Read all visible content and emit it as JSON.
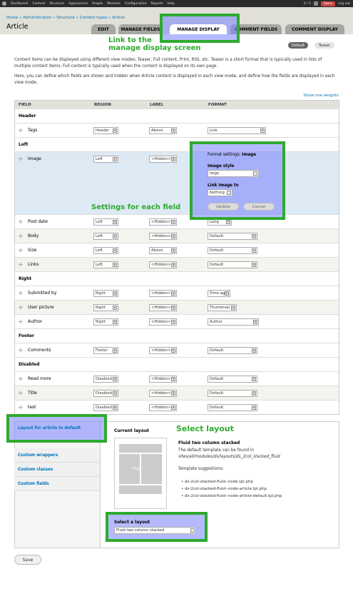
{
  "toolbar": {
    "items": [
      "Dashboard",
      "Content",
      "Structure",
      "Appearance",
      "People",
      "Modules",
      "Configuration",
      "Reports",
      "Help"
    ],
    "counter": "0 / 1",
    "user": "Sams",
    "logout": "Log out"
  },
  "breadcrumb": "Home » Administration » Structure » Content types » Article",
  "page_title": "Article",
  "tabs": [
    "EDIT",
    "MANAGE FIELDS",
    "MANAGE DISPLAY",
    "COMMENT FIELDS",
    "COMMENT DISPLAY"
  ],
  "callouts": {
    "tab_link": "Link to the\nmanage display screen",
    "settings": "Settings for each field",
    "select_layout": "Select layout"
  },
  "view_modes": {
    "default": "Default",
    "teaser": "Teaser"
  },
  "description": {
    "p1": "Content items can be displayed using different view modes: Teaser, Full content, Print, RSS, etc. Teaser is a short format that is typically used in lists of multiple content items. Full content is typically used when the content is displayed on its own page.",
    "p2": "Here, you can define which fields are shown and hidden when Article content is displayed in each view mode, and define how the fields are displayed in each view mode."
  },
  "show_row_weights": "Show row weights",
  "table": {
    "headers": [
      "FIELD",
      "REGION",
      "LABEL",
      "FORMAT"
    ],
    "rows": [
      {
        "type": "region",
        "name": "Header"
      },
      {
        "type": "field",
        "name": "Tags",
        "region": "Header",
        "label": "Above",
        "format": "Link"
      },
      {
        "type": "region",
        "name": "Left"
      },
      {
        "type": "field",
        "name": "Image",
        "region": "Left",
        "label": "<Hidden>",
        "format": ""
      },
      {
        "type": "field",
        "name": "Post date",
        "region": "Left",
        "label": "<Hidden>",
        "format": "Long"
      },
      {
        "type": "field",
        "name": "Body",
        "region": "Left",
        "label": "<Hidden>",
        "format": "Default"
      },
      {
        "type": "field",
        "name": "Size",
        "region": "Left",
        "label": "Above",
        "format": "Default"
      },
      {
        "type": "field",
        "name": "Links",
        "region": "Left",
        "label": "<Hidden>",
        "format": "Default"
      },
      {
        "type": "region",
        "name": "Right"
      },
      {
        "type": "field",
        "name": "Submitted by",
        "region": "Right",
        "label": "<Hidden>",
        "format": "Time ago"
      },
      {
        "type": "field",
        "name": "User picture",
        "region": "Right",
        "label": "<Hidden>",
        "format": "Thumbnail"
      },
      {
        "type": "field",
        "name": "Author",
        "region": "Right",
        "label": "<Hidden>",
        "format": "Author"
      },
      {
        "type": "region",
        "name": "Footer"
      },
      {
        "type": "field",
        "name": "Comments",
        "region": "Footer",
        "label": "<Hidden>",
        "format": "Default"
      },
      {
        "type": "region",
        "name": "Disabled"
      },
      {
        "type": "field",
        "name": "Read more",
        "region": "Disabled",
        "label": "<Hidden>",
        "format": "Default"
      },
      {
        "type": "field",
        "name": "Title",
        "region": "Disabled",
        "label": "<Hidden>",
        "format": "Default"
      },
      {
        "type": "field",
        "name": "test",
        "region": "Disabled",
        "label": "<Hidden>",
        "format": "Default"
      }
    ]
  },
  "format_settings": {
    "title_prefix": "Format settings:",
    "title_field": "Image",
    "image_style_label": "Image style",
    "image_style_value": "large",
    "link_label": "Link image to",
    "link_value": "Nothing",
    "update": "Update",
    "cancel": "Cancel"
  },
  "vertical_tabs": [
    "Layout for article in default",
    "Custom wrappers",
    "Custom classes",
    "Custom fields"
  ],
  "layout": {
    "current_label": "Current layout",
    "preview_text": "Fluid",
    "name": "Fluid two column stacked",
    "desc_prefix": "The default template can be found in",
    "path": "sites/all/modules/ds/layouts/ds_2col_stacked_fluid",
    "suggestions_label": "Template suggestions:",
    "suggestions": [
      "ds-2col-stacked-fluid--node.tpl.php",
      "ds-2col-stacked-fluid--node-article.tpl.php",
      "ds-2col-stacked-fluid--node-article-default.tpl.php"
    ],
    "select_label": "Select a layout",
    "select_value": "Fluid two column stacked"
  },
  "save": "Save",
  "colors": {
    "accent_green": "#2eaa2e",
    "link_blue": "#0074bd",
    "toolbar": "#2b2b2b"
  }
}
